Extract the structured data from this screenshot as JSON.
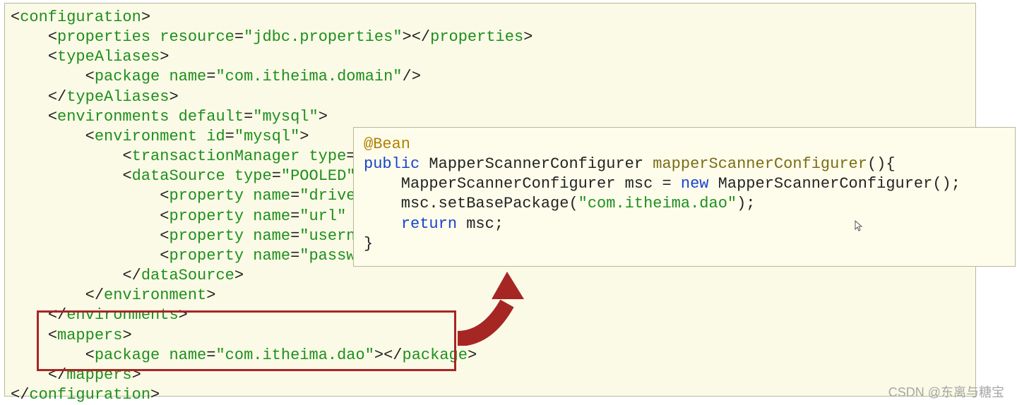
{
  "xml": {
    "l1": "<configuration>",
    "l2": "    <properties resource=\"jdbc.properties\"></properties>",
    "l3": "    <typeAliases>",
    "l4": "        <package name=\"com.itheima.domain\"/>",
    "l5": "    </typeAliases>",
    "l6": "    <environments default=\"mysql\">",
    "l7": "        <environment id=\"mysql\">",
    "l8": "            <transactionManager type=\"J",
    "l9": "            <dataSource type=\"POOLED\">",
    "l10": "                <property name=\"driver\"",
    "l11": "                <property name=\"url\" va",
    "l12": "                <property name=\"usernam",
    "l13": "                <property name=\"passwor",
    "l14": "            </dataSource>",
    "l15": "        </environment>",
    "l16": "    </environments>",
    "l17": "    <mappers>",
    "l18": "        <package name=\"com.itheima.dao\"></package>",
    "l19": "    </mappers>",
    "l20": "</configuration>"
  },
  "java": {
    "annotation": "@Bean",
    "public": "public",
    "cls": "MapperScannerConfigurer",
    "method": "mapperScannerConfigurer",
    "sig_tail": "(){",
    "line2a": "    MapperScannerConfigurer msc = ",
    "new": "new",
    "line2b": " MapperScannerConfigurer();",
    "line3a": "    msc.setBasePackage(",
    "str": "\"com.itheima.dao\"",
    "line3b": ");",
    "return": "return",
    "line4b": " msc;",
    "close": "}"
  },
  "watermark": "CSDN @东离与糖宝"
}
